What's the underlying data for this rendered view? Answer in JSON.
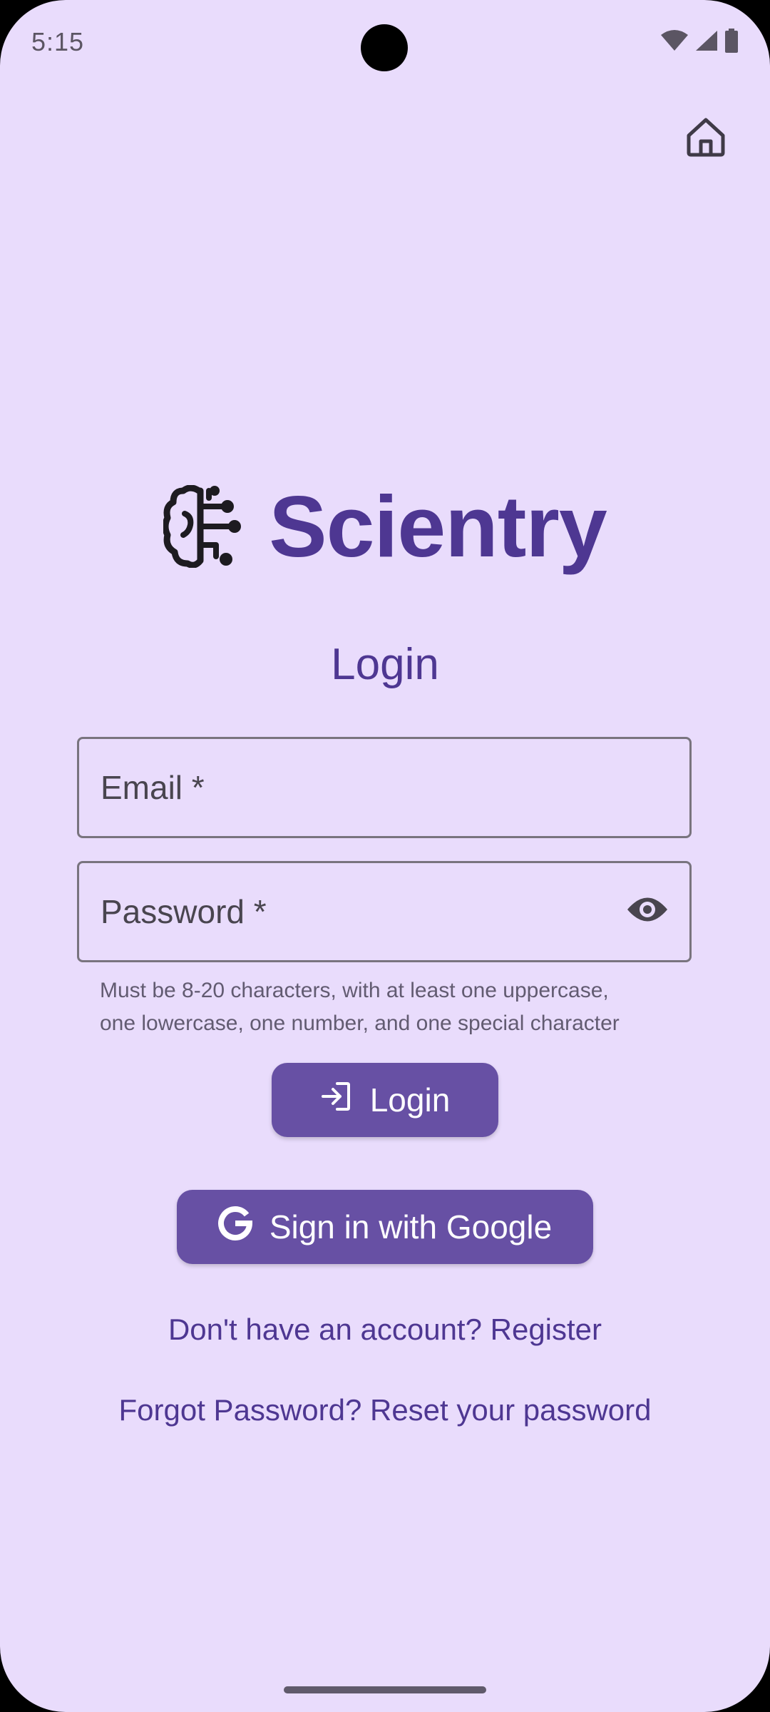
{
  "status_bar": {
    "time": "5:15",
    "icons": [
      "wifi-icon",
      "signal-icon",
      "battery-icon"
    ]
  },
  "header": {
    "home_icon": "home-icon"
  },
  "brand": {
    "logo_icon": "brain-circuit-icon",
    "name": "Scientry"
  },
  "form": {
    "title": "Login",
    "email": {
      "placeholder": "Email *",
      "value": ""
    },
    "password": {
      "placeholder": "Password *",
      "value": "",
      "toggle_icon": "eye-icon"
    },
    "helper_line1": "Must be 8-20 characters, with at least one uppercase,",
    "helper_line2": "one lowercase, one number, and one special character",
    "login_button": {
      "label": "Login",
      "icon": "login-icon"
    },
    "google_button": {
      "label": "Sign in with Google",
      "icon": "google-icon"
    },
    "register_link": "Don't have an account? Register",
    "reset_link": "Forgot Password? Reset your password"
  },
  "colors": {
    "background": "#e9dcfc",
    "primary": "#6750a4",
    "brand_text": "#4e3792",
    "outline": "#79747e"
  }
}
